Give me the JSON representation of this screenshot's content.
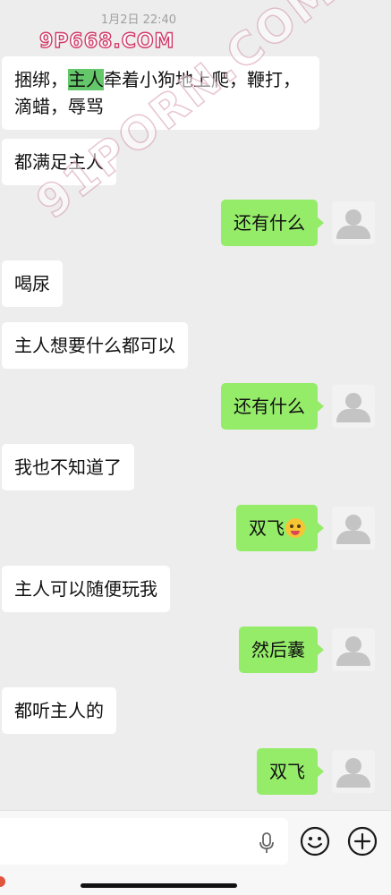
{
  "timestamp": "1月2日 22:40",
  "watermarks": {
    "top": "9P668.COM",
    "diagonal": "91PORN.COM"
  },
  "messages": [
    {
      "side": "left",
      "text": "捆绑，主人牵着小狗地上爬，鞭打，滴蜡，辱骂",
      "highlight": "主人"
    },
    {
      "side": "left",
      "text": "都满足主人"
    },
    {
      "side": "right",
      "text": "还有什么"
    },
    {
      "side": "left",
      "text": "喝尿"
    },
    {
      "side": "left",
      "text": "主人想要什么都可以"
    },
    {
      "side": "right",
      "text": "还有什么"
    },
    {
      "side": "left",
      "text": "我也不知道了"
    },
    {
      "side": "right",
      "text": "双飞",
      "emoji": "grimacing-face"
    },
    {
      "side": "left",
      "text": "主人可以随便玩我"
    },
    {
      "side": "right",
      "text": "然后囊"
    },
    {
      "side": "left",
      "text": "都听主人的"
    },
    {
      "side": "right",
      "text": "双飞"
    }
  ],
  "input_bar": {
    "icons": [
      "microphone-icon",
      "emoji-icon",
      "plus-icon"
    ]
  },
  "colors": {
    "background": "#ededed",
    "sent_bubble": "#95ec69",
    "received_bubble": "#ffffff",
    "highlight": "#64c86a"
  }
}
